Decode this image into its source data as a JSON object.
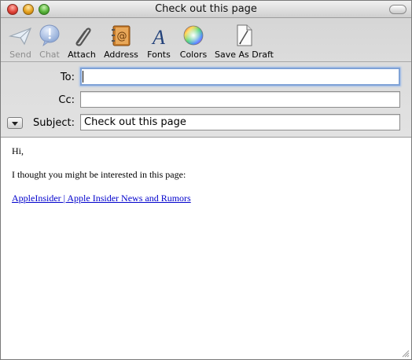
{
  "window": {
    "title": "Check out this page"
  },
  "toolbar": {
    "send": "Send",
    "chat": "Chat",
    "attach": "Attach",
    "address": "Address",
    "fonts": "Fonts",
    "colors": "Colors",
    "save_draft": "Save As Draft"
  },
  "header": {
    "to_label": "To:",
    "to_value": "",
    "cc_label": "Cc:",
    "cc_value": "",
    "subject_label": "Subject:",
    "subject_value": "Check out this page"
  },
  "message": {
    "greeting": "Hi,",
    "line": "I thought you might be interested in this page:",
    "link": "AppleInsider | Apple Insider News and Rumors"
  }
}
